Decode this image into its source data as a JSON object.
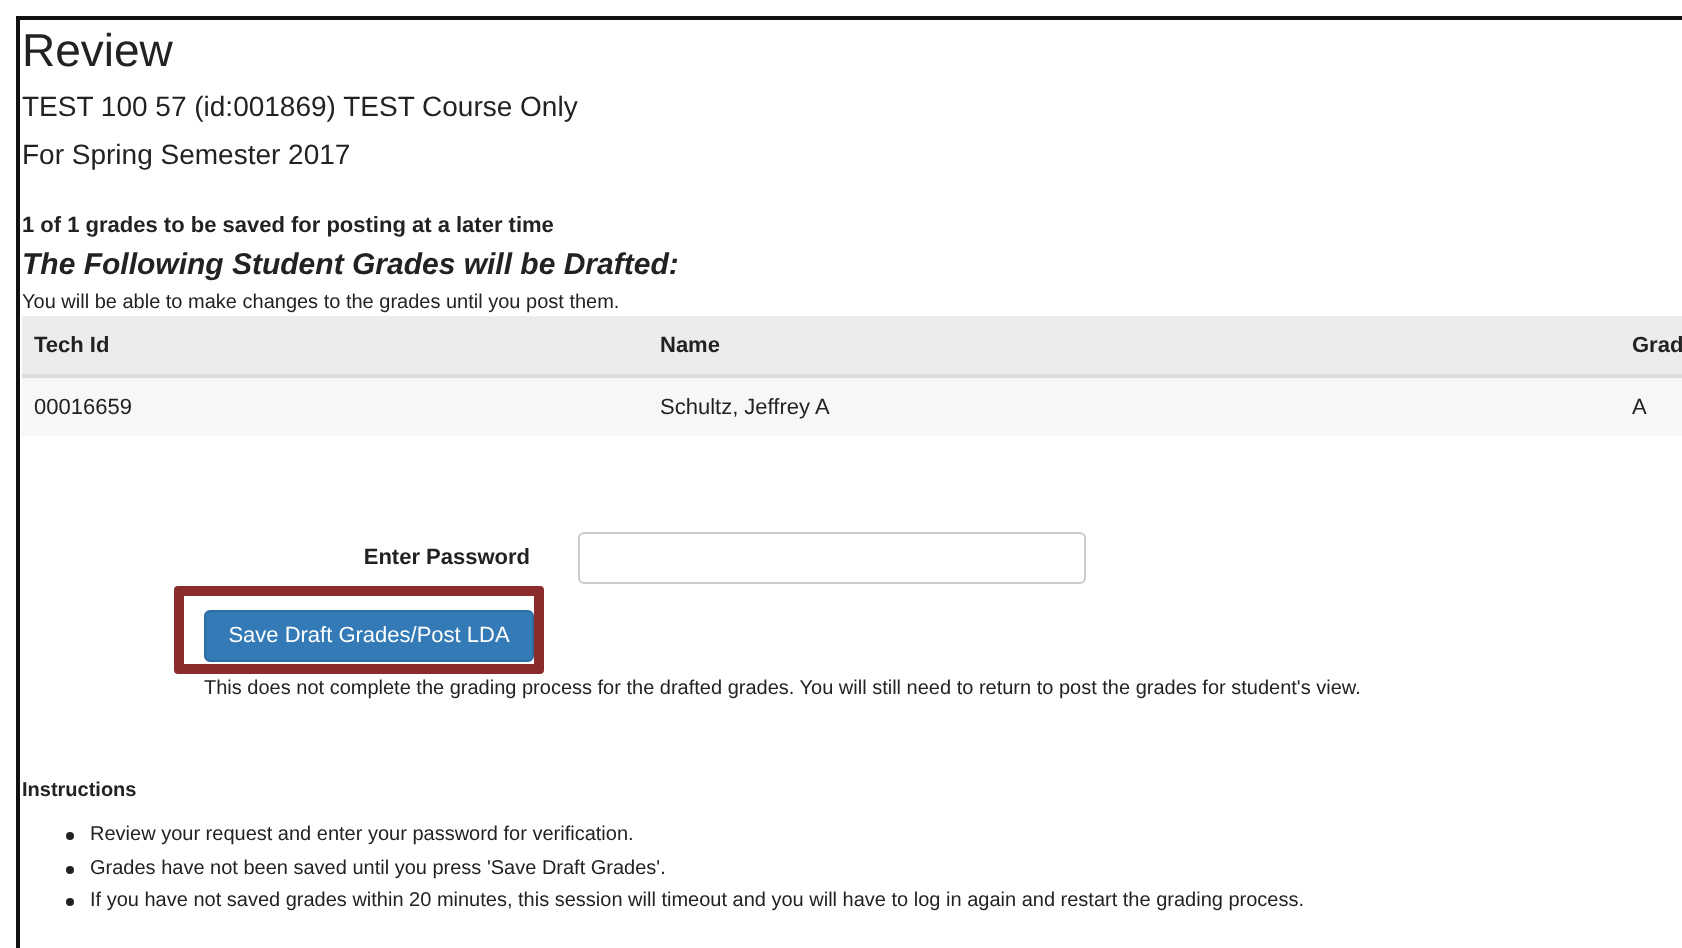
{
  "title": "Review",
  "course": "TEST 100 57 (id:001869) TEST Course Only",
  "term": "For Spring Semester 2017",
  "summary": "1 of 1 grades to be saved for posting at a later time",
  "heading": "The Following Student Grades will be Drafted:",
  "subtext": "You will be able to make changes to the grades until you post them.",
  "table": {
    "columns": [
      "Tech Id",
      "Name",
      "Grad"
    ],
    "rows": [
      [
        "00016659",
        "Schultz, Jeffrey A",
        "A"
      ]
    ]
  },
  "password": {
    "label": "Enter Password"
  },
  "save_button": {
    "label": "Save Draft Grades/Post LDA",
    "highlighted": true
  },
  "note": "This does not complete the grading process for the drafted grades. You will still need to return to post the grades for student's view.",
  "instructions": {
    "title": "Instructions",
    "items": [
      "Review your request and enter your password for verification.",
      "Grades have not been saved until you press 'Save Draft Grades'.",
      "If you have not saved grades within 20 minutes, this session will timeout and you will have to log in again and restart the grading process."
    ]
  }
}
